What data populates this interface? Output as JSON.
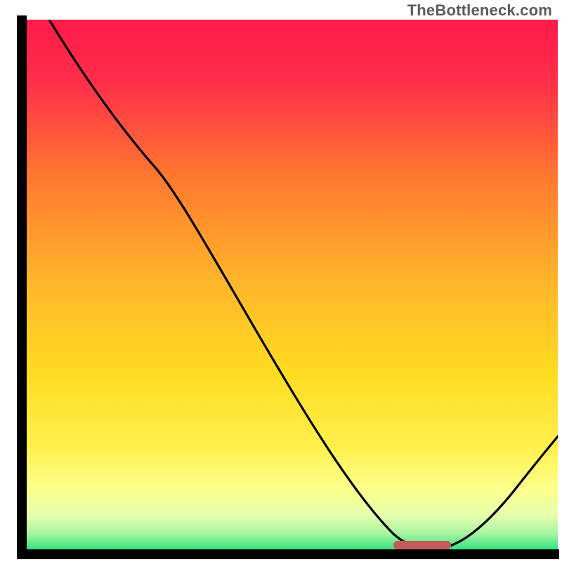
{
  "watermark": {
    "text": "TheBottleneck.com"
  },
  "chart_data": {
    "type": "line",
    "title": "",
    "xlabel": "",
    "ylabel": "",
    "xlim": [
      0,
      100
    ],
    "ylim": [
      0,
      100
    ],
    "grid": false,
    "legend": false,
    "annotations": [],
    "series": [
      {
        "name": "curve",
        "x": [
          6,
          25,
          71,
          80,
          100
        ],
        "y": [
          100,
          74,
          2,
          1,
          21
        ],
        "note": "Approximate values read off plot area; the curve descends steeply, flattens near the bottom around x≈71–80, then rises toward the right edge."
      }
    ],
    "marker": {
      "name": "highlight-segment",
      "x_range": [
        70,
        80
      ],
      "y": 2,
      "color": "#c55a5a"
    },
    "background_gradient": {
      "top": "#ff1a4a",
      "upper_mid": "#ff8a2a",
      "mid": "#ffd400",
      "lower_mid": "#fff56a",
      "lower": "#f6ffb0",
      "bottom": "#1fe07a"
    },
    "frame_color": "#000000",
    "frame_thickness_px": 12
  }
}
